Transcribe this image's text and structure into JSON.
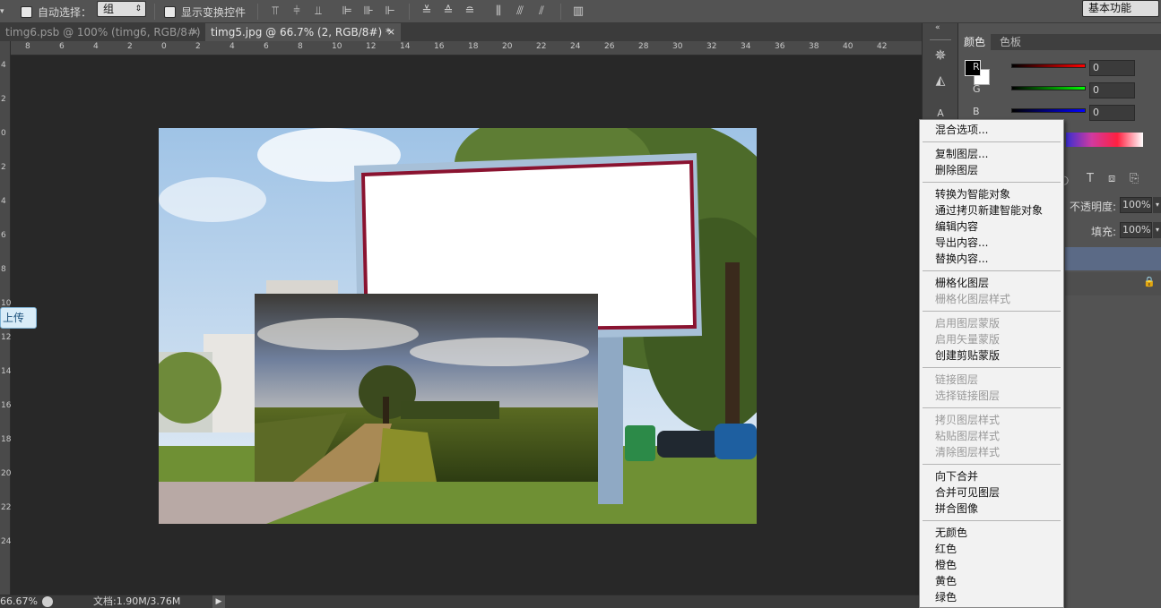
{
  "options_bar": {
    "auto_select_label": "自动选择：",
    "auto_select_value": "组",
    "show_transform_label": "显示变换控件",
    "workspace": "基本功能"
  },
  "tabs": [
    {
      "label": "timg6.psb @ 100% (timg6, RGB/8#)",
      "close": "×"
    },
    {
      "label": "timg5.jpg @ 66.7% (2, RGB/8#) *",
      "close": "×"
    }
  ],
  "ruler": {
    "h_ticks": [
      "8",
      "6",
      "4",
      "2",
      "0",
      "2",
      "4",
      "6",
      "8",
      "10",
      "12",
      "14",
      "16",
      "18",
      "20",
      "22",
      "24",
      "26",
      "28",
      "30",
      "32",
      "34",
      "36",
      "38",
      "40",
      "42"
    ],
    "v_ticks": [
      "4",
      "2",
      "0",
      "2",
      "4",
      "6",
      "8",
      "10",
      "12",
      "14",
      "16",
      "18",
      "20",
      "22",
      "24"
    ]
  },
  "upload_button": "上传",
  "status_bar": {
    "zoom": "66.67%",
    "doc_info": "文档:1.90M/3.76M"
  },
  "color_panel": {
    "tabs": [
      "颜色",
      "色板"
    ],
    "r_label": "R",
    "r_value": "0",
    "g_label": "G",
    "g_value": "0",
    "b_label": "B",
    "b_value": "0"
  },
  "layers_panel": {
    "opacity_label": "不透明度:",
    "opacity_value": "100%",
    "fill_label": "填充:",
    "fill_value": "100%"
  },
  "context_menu": {
    "items": [
      {
        "label": "混合选项...",
        "disabled": false
      },
      {
        "label": "复制图层...",
        "disabled": false
      },
      {
        "label": "删除图层",
        "disabled": false
      },
      {
        "label": "转换为智能对象",
        "disabled": false
      },
      {
        "label": "通过拷贝新建智能对象",
        "disabled": false
      },
      {
        "label": "编辑内容",
        "disabled": false
      },
      {
        "label": "导出内容...",
        "disabled": false
      },
      {
        "label": "替换内容...",
        "disabled": false
      },
      {
        "label": "栅格化图层",
        "disabled": false
      },
      {
        "label": "栅格化图层样式",
        "disabled": true
      },
      {
        "label": "启用图层蒙版",
        "disabled": true
      },
      {
        "label": "启用矢量蒙版",
        "disabled": true
      },
      {
        "label": "创建剪贴蒙版",
        "disabled": false
      },
      {
        "label": "链接图层",
        "disabled": true
      },
      {
        "label": "选择链接图层",
        "disabled": true
      },
      {
        "label": "拷贝图层样式",
        "disabled": true
      },
      {
        "label": "粘贴图层样式",
        "disabled": true
      },
      {
        "label": "清除图层样式",
        "disabled": true
      },
      {
        "label": "向下合并",
        "disabled": false
      },
      {
        "label": "合并可见图层",
        "disabled": false
      },
      {
        "label": "拼合图像",
        "disabled": false
      },
      {
        "label": "无颜色",
        "disabled": false
      },
      {
        "label": "红色",
        "disabled": false
      },
      {
        "label": "橙色",
        "disabled": false
      },
      {
        "label": "黄色",
        "disabled": false
      },
      {
        "label": "绿色",
        "disabled": false
      }
    ]
  }
}
